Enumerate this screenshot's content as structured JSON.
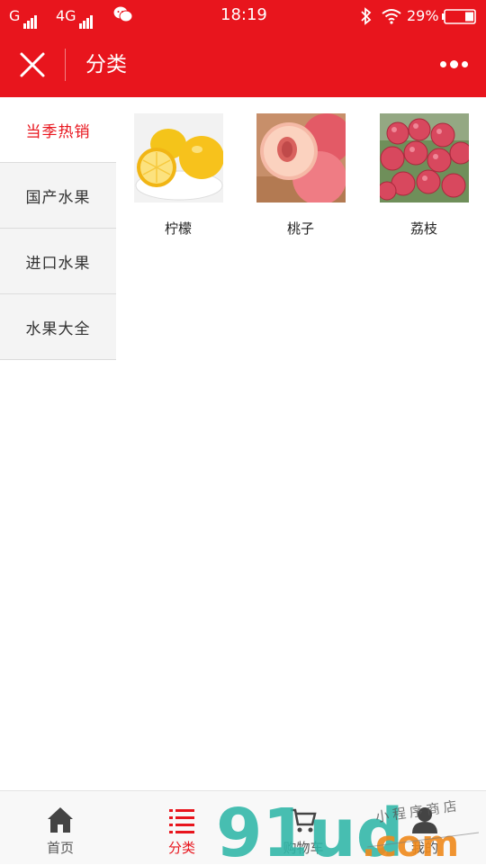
{
  "status_bar": {
    "carrier1": "G",
    "carrier2": "4G",
    "time": "18:19",
    "battery": "29%"
  },
  "nav": {
    "title": "分类"
  },
  "sidebar": {
    "items": [
      {
        "label": "当季热销",
        "active": true
      },
      {
        "label": "国产水果",
        "active": false
      },
      {
        "label": "进口水果",
        "active": false
      },
      {
        "label": "水果大全",
        "active": false
      }
    ]
  },
  "products": [
    {
      "name": "柠檬",
      "icon": "lemon-image"
    },
    {
      "name": "桃子",
      "icon": "peach-image"
    },
    {
      "name": "荔枝",
      "icon": "lychee-image"
    }
  ],
  "tabbar": {
    "items": [
      {
        "label": "首页",
        "icon": "home-icon",
        "active": false
      },
      {
        "label": "分类",
        "icon": "list-icon",
        "active": true
      },
      {
        "label": "购物车",
        "icon": "cart-icon",
        "active": false
      },
      {
        "label": "我的",
        "icon": "user-icon",
        "active": false
      }
    ]
  },
  "watermark": {
    "brand": "91ud",
    "tld": ".com",
    "tagline": "小程序商店"
  },
  "colors": {
    "brand": "#e8151d",
    "watermark_teal": "#2fb7a8",
    "watermark_orange": "#f08a1c"
  }
}
